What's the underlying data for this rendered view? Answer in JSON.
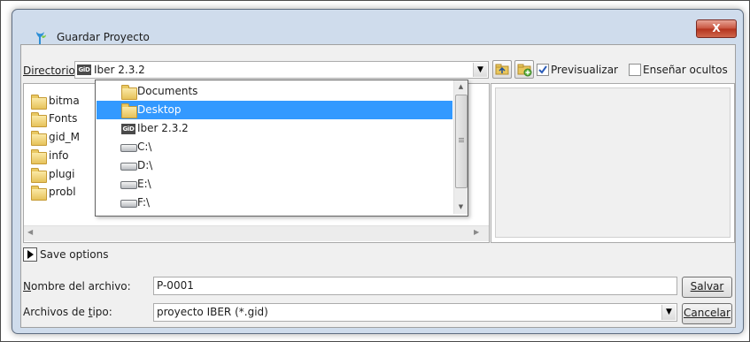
{
  "window": {
    "title": "Guardar Proyecto",
    "close_label": "X"
  },
  "toolbar": {
    "directory_label": "Directorio:",
    "directory_value": "Iber 2.3.2",
    "gid_logo": "GiD",
    "preview_label": "Previsualizar",
    "preview_checked": true,
    "show_hidden_label": "Enseñar ocultos",
    "show_hidden_checked": false
  },
  "file_list": [
    {
      "label": "bitma",
      "icon": "folder-icon"
    },
    {
      "label": "Fonts",
      "icon": "folder-icon"
    },
    {
      "label": "gid_M",
      "icon": "folder-icon"
    },
    {
      "label": "info",
      "icon": "folder-icon"
    },
    {
      "label": "plugi",
      "icon": "folder-icon"
    },
    {
      "label": "probl",
      "icon": "folder-icon"
    }
  ],
  "directory_dropdown": {
    "items": [
      {
        "label": "Documents",
        "icon": "folder-icon",
        "selected": false
      },
      {
        "label": "Desktop",
        "icon": "folder-icon",
        "selected": true
      },
      {
        "label": "Iber 2.3.2",
        "icon": "gid-icon",
        "selected": false
      },
      {
        "label": "C:\\",
        "icon": "drive-icon",
        "selected": false
      },
      {
        "label": "D:\\",
        "icon": "drive-icon",
        "selected": false
      },
      {
        "label": "E:\\",
        "icon": "drive-icon",
        "selected": false
      },
      {
        "label": "F:\\",
        "icon": "drive-icon",
        "selected": false
      }
    ]
  },
  "save_options": {
    "label": "Save options",
    "expanded": false
  },
  "filename": {
    "label": "Nombre del archivo:",
    "value": "P-0001"
  },
  "filetype": {
    "label": "Archivos de tipo:",
    "value": "proyecto IBER (*.gid)"
  },
  "buttons": {
    "save": "Salvar",
    "cancel": "Cancelar"
  },
  "colors": {
    "selection": "#3399ff",
    "window_frame": "#cfdcec",
    "close_button": "#c8533d"
  }
}
